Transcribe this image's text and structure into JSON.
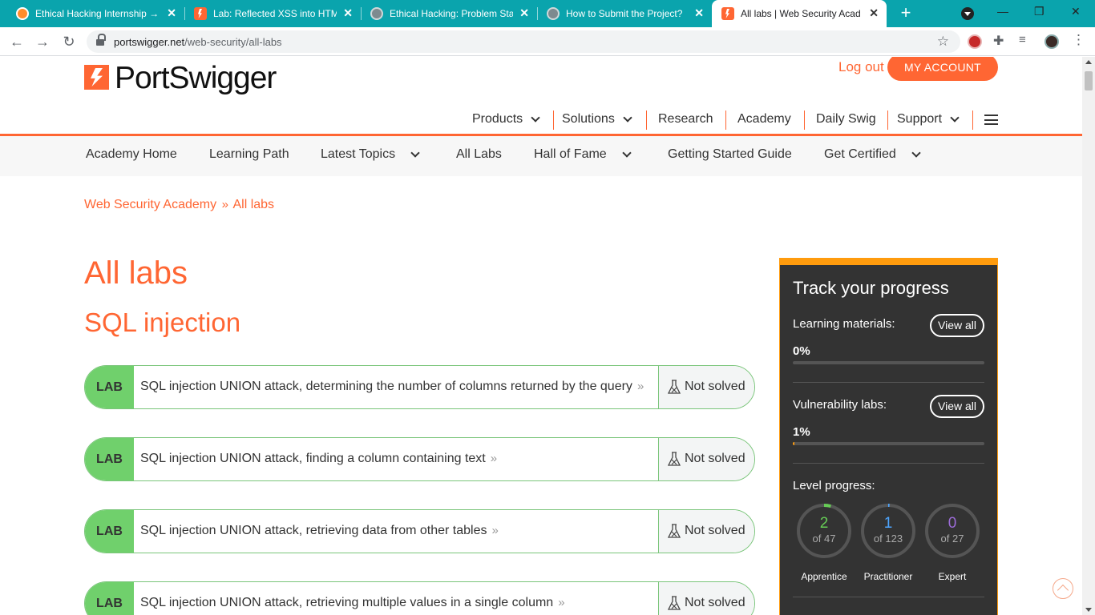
{
  "browser": {
    "tabs": [
      {
        "title": "Ethical Hacking Internship →",
        "icon": "internshala-icon"
      },
      {
        "title": "Lab: Reflected XSS into HTML",
        "icon": "portswigger-icon"
      },
      {
        "title": "Ethical Hacking: Problem Stat",
        "icon": "globe-icon"
      },
      {
        "title": "How to Submit the Project?",
        "icon": "globe-icon"
      },
      {
        "title": "All labs | Web Security Acade",
        "icon": "portswigger-icon",
        "active": true
      }
    ],
    "new_tab": "+",
    "url_host": "portswigger.net",
    "url_path": "/web-security/all-labs",
    "window_controls": [
      "—",
      "❐",
      "✕"
    ],
    "theme_color": "#0aa4ad"
  },
  "site": {
    "brand": "PortSwigger",
    "accent": "#ff6633",
    "logout": "Log out",
    "my_account": "MY ACCOUNT",
    "top_nav": [
      "Products",
      "Solutions",
      "Research",
      "Academy",
      "Daily Swig",
      "Support"
    ],
    "sub_nav": [
      "Academy Home",
      "Learning Path",
      "Latest Topics",
      "All Labs",
      "Hall of Fame",
      "Getting Started Guide",
      "Get Certified"
    ]
  },
  "breadcrumb": {
    "home": "Web Security Academy",
    "separator": "»",
    "current": "All labs"
  },
  "main": {
    "title": "All labs",
    "section": "SQL injection",
    "lab_badge": "LAB",
    "labs": [
      {
        "title": "SQL injection UNION attack, determining the number of columns returned by the query",
        "status": "Not solved"
      },
      {
        "title": "SQL injection UNION attack, finding a column containing text",
        "status": "Not solved"
      },
      {
        "title": "SQL injection UNION attack, retrieving data from other tables",
        "status": "Not solved"
      },
      {
        "title": "SQL injection UNION attack, retrieving multiple values in a single column",
        "status": "Not solved"
      }
    ],
    "lab_arrow": "»"
  },
  "progress": {
    "title": "Track your progress",
    "learning_label": "Learning materials:",
    "learning_pct": "0%",
    "learning_value": 0,
    "vuln_label": "Vulnerability labs:",
    "vuln_pct": "1%",
    "vuln_value": 0.01,
    "view_all": "View all",
    "level_label": "Level progress:",
    "levels": [
      {
        "name": "Apprentice",
        "count": "2",
        "total": "of 47",
        "done": 2,
        "max": 47,
        "color": "#66cc55"
      },
      {
        "name": "Practitioner",
        "count": "1",
        "total": "of 123",
        "done": 1,
        "max": 123,
        "color": "#4da6ff"
      },
      {
        "name": "Expert",
        "count": "0",
        "total": "of 27",
        "done": 0,
        "max": 27,
        "color": "#9b6bd6"
      }
    ],
    "panel_accent": "#ff9b0d"
  }
}
